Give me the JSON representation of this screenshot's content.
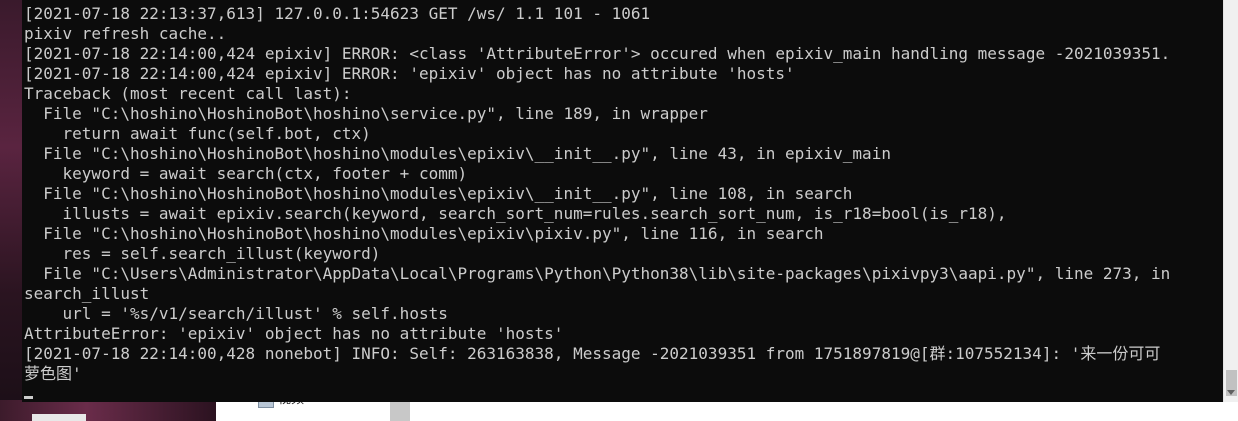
{
  "console": {
    "lines": [
      "[2021-07-18 22:13:37,613] 127.0.0.1:54623 GET /ws/ 1.1 101 - 1061",
      "pixiv refresh cache..",
      "[2021-07-18 22:14:00,424 epixiv] ERROR: <class 'AttributeError'> occured when epixiv_main handling message -2021039351.",
      "[2021-07-18 22:14:00,424 epixiv] ERROR: 'epixiv' object has no attribute 'hosts'",
      "Traceback (most recent call last):",
      "  File \"C:\\hoshino\\HoshinoBot\\hoshino\\service.py\", line 189, in wrapper",
      "    return await func(self.bot, ctx)",
      "  File \"C:\\hoshino\\HoshinoBot\\hoshino\\modules\\epixiv\\__init__.py\", line 43, in epixiv_main",
      "    keyword = await search(ctx, footer + comm)",
      "  File \"C:\\hoshino\\HoshinoBot\\hoshino\\modules\\epixiv\\__init__.py\", line 108, in search",
      "    illusts = await epixiv.search(keyword, search_sort_num=rules.search_sort_num, is_r18=bool(is_r18),",
      "  File \"C:\\hoshino\\HoshinoBot\\hoshino\\modules\\epixiv\\pixiv.py\", line 116, in search",
      "    res = self.search_illust(keyword)",
      "  File \"C:\\Users\\Administrator\\AppData\\Local\\Programs\\Python\\Python38\\lib\\site-packages\\pixivpy3\\aapi.py\", line 273, in",
      "search_illust",
      "    url = '%s/v1/search/illust' % self.hosts",
      "AttributeError: 'epixiv' object has no attribute 'hosts'",
      "[2021-07-18 22:14:00,428 nonebot] INFO: Self: 263163838, Message -2021039351 from 1751897819@[群:107552134]: '来一份可可",
      "萝色图'"
    ]
  },
  "background": {
    "window_label": "视频"
  }
}
